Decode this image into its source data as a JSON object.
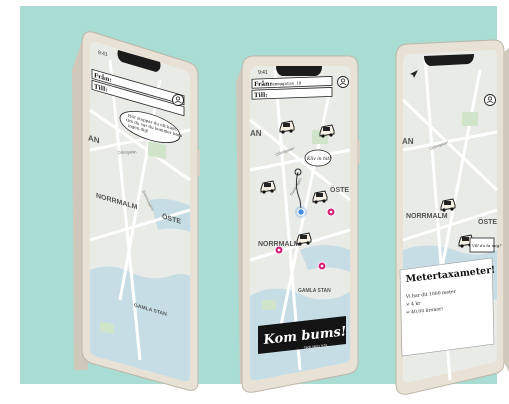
{
  "colors": {
    "background": "#a9dcd3",
    "phone_frame": "#e8e2d6",
    "map_land": "#e9ebe6",
    "map_water": "#c6dde6",
    "map_road": "#ffffff",
    "accent_pin": "#d4237c",
    "accent_location": "#3d8be0"
  },
  "phone_left": {
    "status_time": "9:41",
    "from_label": "Från:",
    "to_label": "Till:",
    "bubble_lines": [
      "Hör stoppar du ett kum.",
      "Om du var du kommer bara",
      "ingen dig!"
    ],
    "district_normalm": "NORRMALM",
    "district_oster": "ÖSTE",
    "district_gamla": "GAMLA STAN",
    "district_an": "AN",
    "street_1": "Odengatan",
    "street_2": "Sveavägen"
  },
  "phone_center": {
    "status_time": "9:41",
    "from_label": "Från:",
    "from_value": "Hemmagatan 10",
    "to_label": "Till:",
    "car_bubble": "Kliv in hit!",
    "district_normalm": "NORRMALM",
    "district_oster": "ÖSTE",
    "district_gamla": "GAMLA STAN",
    "district_an": "AN",
    "street_1": "Odengatan",
    "street_2": "Sveavägen",
    "logo_text": "Kom bums!",
    "logo_sub": "TAXI MED STIL"
  },
  "phone_right": {
    "district_normalm": "NORRMALM",
    "district_oster": "ÖSTE",
    "district_an": "AN",
    "street_1": "Odengatan",
    "flag_text": "Vill du ta mig?",
    "meter_title": "Metertaxameter!",
    "meter_lines": [
      "Vi har dit 1000 meter",
      "× 4 kr",
      "= 40,00 kronor!"
    ]
  }
}
